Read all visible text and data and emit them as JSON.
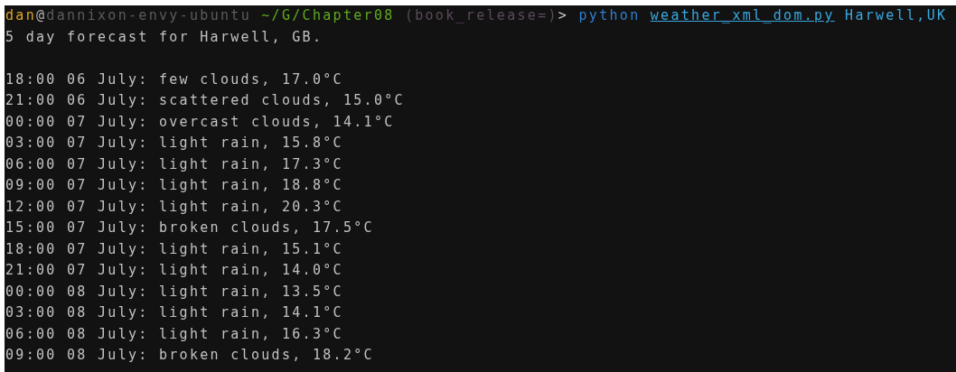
{
  "prompt": [
    {
      "kind": "user",
      "text": "dan"
    },
    {
      "kind": "at",
      "text": "@"
    },
    {
      "kind": "host",
      "text": "dannixon-envy-ubuntu"
    },
    {
      "kind": "cwd",
      "text": "~/G/Chapter08"
    },
    {
      "kind": "branch",
      "text": "(book_release=)"
    },
    {
      "kind": "symbol",
      "text": ">"
    },
    {
      "kind": "command",
      "text": "python"
    },
    {
      "kind": "script",
      "text": "weather_xml_dom.py"
    },
    {
      "kind": "args",
      "text": "Harwell,UK"
    }
  ],
  "summary": "5 day forecast for Harwell, GB.",
  "forecast": [
    "18:00 06 July: few clouds, 17.0°C",
    "21:00 06 July: scattered clouds, 15.0°C",
    "00:00 07 July: overcast clouds, 14.1°C",
    "03:00 07 July: light rain, 15.8°C",
    "06:00 07 July: light rain, 17.3°C",
    "09:00 07 July: light rain, 18.8°C",
    "12:00 07 July: light rain, 20.3°C",
    "15:00 07 July: broken clouds, 17.5°C",
    "18:00 07 July: light rain, 15.1°C",
    "21:00 07 July: light rain, 14.0°C",
    "00:00 08 July: light rain, 13.5°C",
    "03:00 08 July: light rain, 14.1°C",
    "06:00 08 July: light rain, 16.3°C",
    "09:00 08 July: broken clouds, 18.2°C"
  ]
}
